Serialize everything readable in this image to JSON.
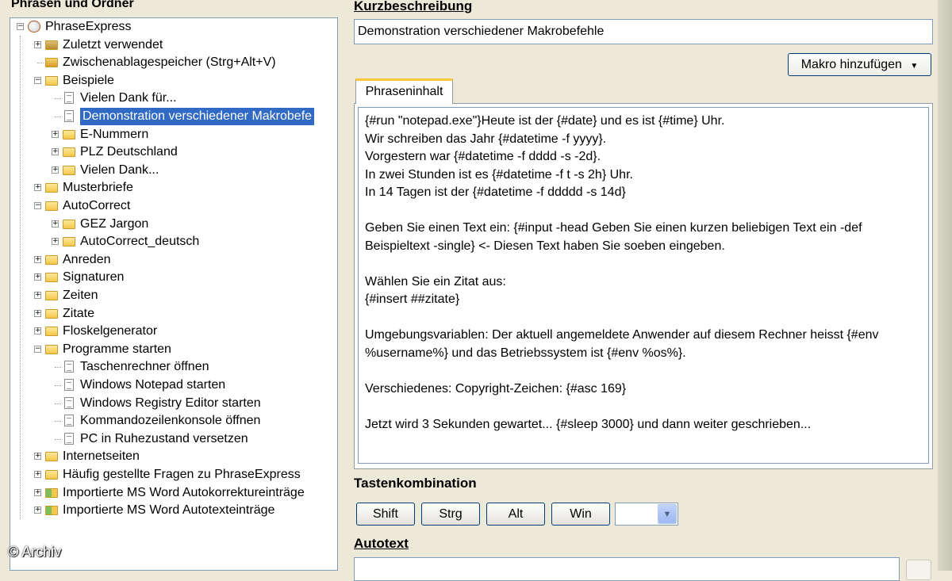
{
  "left_panel": {
    "title": "Phrasen und Ordner"
  },
  "tree": [
    {
      "label": "PhraseExpress",
      "level": 0,
      "expander": "⊟",
      "icon": "phraseexpress-icon"
    },
    {
      "label": "Zuletzt verwendet",
      "level": 1,
      "expander": "⊞",
      "icon": "recent-folder-icon"
    },
    {
      "label": "Zwischenablagespeicher (Strg+Alt+V)",
      "level": 1,
      "expander": "",
      "icon": "clipboard-icon"
    },
    {
      "label": "Beispiele",
      "level": 1,
      "expander": "⊟",
      "icon": "folder-icon"
    },
    {
      "label": "Vielen Dank für...",
      "level": 2,
      "expander": "",
      "icon": "document-icon"
    },
    {
      "label": "Demonstration verschiedener Makrobefe",
      "level": 2,
      "expander": "",
      "icon": "document-icon",
      "selected": true
    },
    {
      "label": "E-Nummern",
      "level": 2,
      "expander": "⊞",
      "icon": "folder-icon"
    },
    {
      "label": "PLZ Deutschland",
      "level": 2,
      "expander": "⊞",
      "icon": "folder-icon"
    },
    {
      "label": "Vielen Dank...",
      "level": 2,
      "expander": "⊞",
      "icon": "folder-icon"
    },
    {
      "label": "Musterbriefe",
      "level": 1,
      "expander": "⊞",
      "icon": "folder-icon"
    },
    {
      "label": "AutoCorrect",
      "level": 1,
      "expander": "⊟",
      "icon": "folder-icon"
    },
    {
      "label": "GEZ Jargon",
      "level": 2,
      "expander": "⊞",
      "icon": "folder-icon"
    },
    {
      "label": "AutoCorrect_deutsch",
      "level": 2,
      "expander": "⊞",
      "icon": "folder-icon"
    },
    {
      "label": "Anreden",
      "level": 1,
      "expander": "⊞",
      "icon": "folder-icon"
    },
    {
      "label": "Signaturen",
      "level": 1,
      "expander": "⊞",
      "icon": "folder-icon"
    },
    {
      "label": "Zeiten",
      "level": 1,
      "expander": "⊞",
      "icon": "folder-icon"
    },
    {
      "label": "Zitate",
      "level": 1,
      "expander": "⊞",
      "icon": "folder-icon"
    },
    {
      "label": "Floskelgenerator",
      "level": 1,
      "expander": "⊞",
      "icon": "folder-icon"
    },
    {
      "label": "Programme starten",
      "level": 1,
      "expander": "⊟",
      "icon": "folder-icon"
    },
    {
      "label": "Taschenrechner öffnen",
      "level": 2,
      "expander": "",
      "icon": "document-icon"
    },
    {
      "label": "Windows Notepad starten",
      "level": 2,
      "expander": "",
      "icon": "document-icon"
    },
    {
      "label": "Windows Registry Editor starten",
      "level": 2,
      "expander": "",
      "icon": "document-icon"
    },
    {
      "label": "Kommandozeilenkonsole öffnen",
      "level": 2,
      "expander": "",
      "icon": "document-icon"
    },
    {
      "label": "PC in Ruhezustand versetzen",
      "level": 2,
      "expander": "",
      "icon": "document-icon"
    },
    {
      "label": "Internetseiten",
      "level": 1,
      "expander": "⊞",
      "icon": "folder-icon"
    },
    {
      "label": "Häufig gestellte Fragen zu PhraseExpress",
      "level": 1,
      "expander": "⊞",
      "icon": "folder-icon"
    },
    {
      "label": "Importierte MS Word Autokorrektureinträge",
      "level": 1,
      "expander": "⊞",
      "icon": "word-import-icon"
    },
    {
      "label": "Importierte MS Word Autotexteinträge",
      "level": 1,
      "expander": "⊞",
      "icon": "word-import-icon"
    }
  ],
  "right_panel": {
    "description_label": "Kurzbeschreibung",
    "description_value": "Demonstration verschiedener Makrobefehle",
    "macro_button": "Makro hinzufügen",
    "tab_label": "Phraseninhalt",
    "content": "{#run \"notepad.exe\"}Heute ist der {#date} und es ist {#time} Uhr.\nWir schreiben das Jahr {#datetime -f yyyy}.\nVorgestern war {#datetime -f dddd -s -2d}.\nIn zwei Stunden ist es {#datetime -f t -s 2h} Uhr.\nIn 14 Tagen ist der {#datetime -f ddddd -s 14d}\n\nGeben Sie einen Text ein: {#input -head Geben Sie einen kurzen beliebigen Text ein -def Beispieltext -single} <- Diesen Text haben Sie soeben eingeben.\n\nWählen Sie ein Zitat aus:\n{#insert ##zitate}\n\nUmgebungsvariablen: Der aktuell angemeldete Anwender auf diesem Rechner heisst {#env %username%} und das Betriebssystem ist {#env %os%}.\n\nVerschiedenes: Copyright-Zeichen: {#asc 169}\n\nJetzt wird 3 Sekunden gewartet... {#sleep 3000} und dann weiter geschrieben...",
    "hotkey_label": "Tastenkombination",
    "hotkey_buttons": [
      "Shift",
      "Strg",
      "Alt",
      "Win"
    ],
    "autotext_label": "Autotext"
  },
  "watermark": "© Archiv",
  "colors": {
    "selection": "#316AC5",
    "tab_highlight": "#FFC83C",
    "window_bg": "#ECE9D8"
  }
}
